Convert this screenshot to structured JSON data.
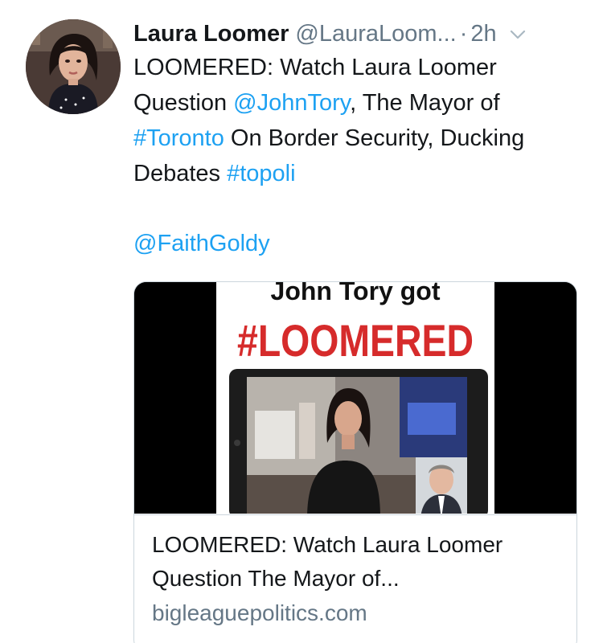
{
  "tweet": {
    "display_name": "Laura Loomer",
    "handle": "@LauraLoom...",
    "separator": "·",
    "time": "2h",
    "text_parts": [
      {
        "text": "LOOMERED: Watch Laura Loomer Question ",
        "link": false
      },
      {
        "text": "@JohnTory",
        "link": true
      },
      {
        "text": ", The Mayor of ",
        "link": false
      },
      {
        "text": "#Toronto",
        "link": true
      },
      {
        "text": " On Border Security, Ducking Debates ",
        "link": false
      },
      {
        "text": "#topoli",
        "link": true
      }
    ],
    "mention": "@FaithGoldy",
    "avatar_icon": "profile-photo",
    "menu_icon": "chevron-down-icon"
  },
  "card": {
    "image_headline_top": "John Tory got",
    "image_headline_main": "#LOOMERED",
    "title": "LOOMERED: Watch Laura Loomer Question The Mayor of...",
    "domain": "bigleaguepolitics.com"
  },
  "colors": {
    "link": "#1da1f2",
    "muted": "#657786",
    "text": "#14171a",
    "headline_red": "#d62b2b",
    "border": "#ccd6dd"
  }
}
